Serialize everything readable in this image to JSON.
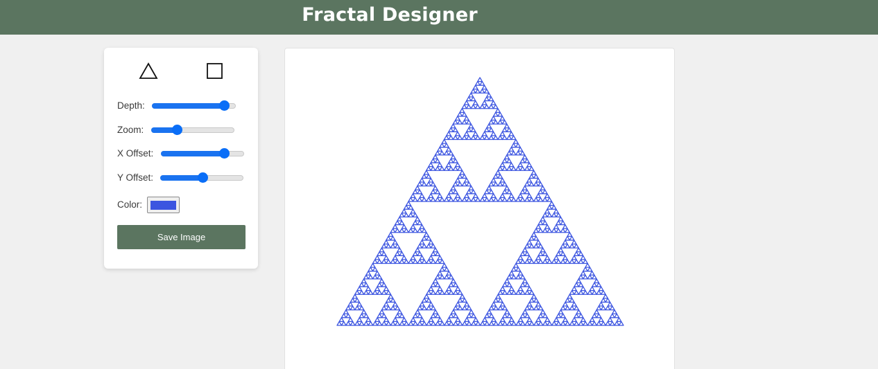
{
  "header": {
    "title": "Fractal Designer"
  },
  "shapes": [
    {
      "icon": "triangle-icon",
      "label": "Triangle"
    },
    {
      "icon": "square-icon",
      "label": "Square"
    }
  ],
  "controls": {
    "depth": {
      "label": "Depth:",
      "value": 0.85
    },
    "zoom": {
      "label": "Zoom:",
      "value": 0.3
    },
    "x_offset": {
      "label": "X Offset:",
      "value": 0.75
    },
    "y_offset": {
      "label": "Y Offset:",
      "value": 0.5
    },
    "color": {
      "label": "Color:",
      "value": "#3c55e0"
    }
  },
  "save_button": {
    "label": "Save Image"
  },
  "fractal": {
    "type": "sierpinski-triangle",
    "depth": 6,
    "color": "#3c55e0"
  }
}
